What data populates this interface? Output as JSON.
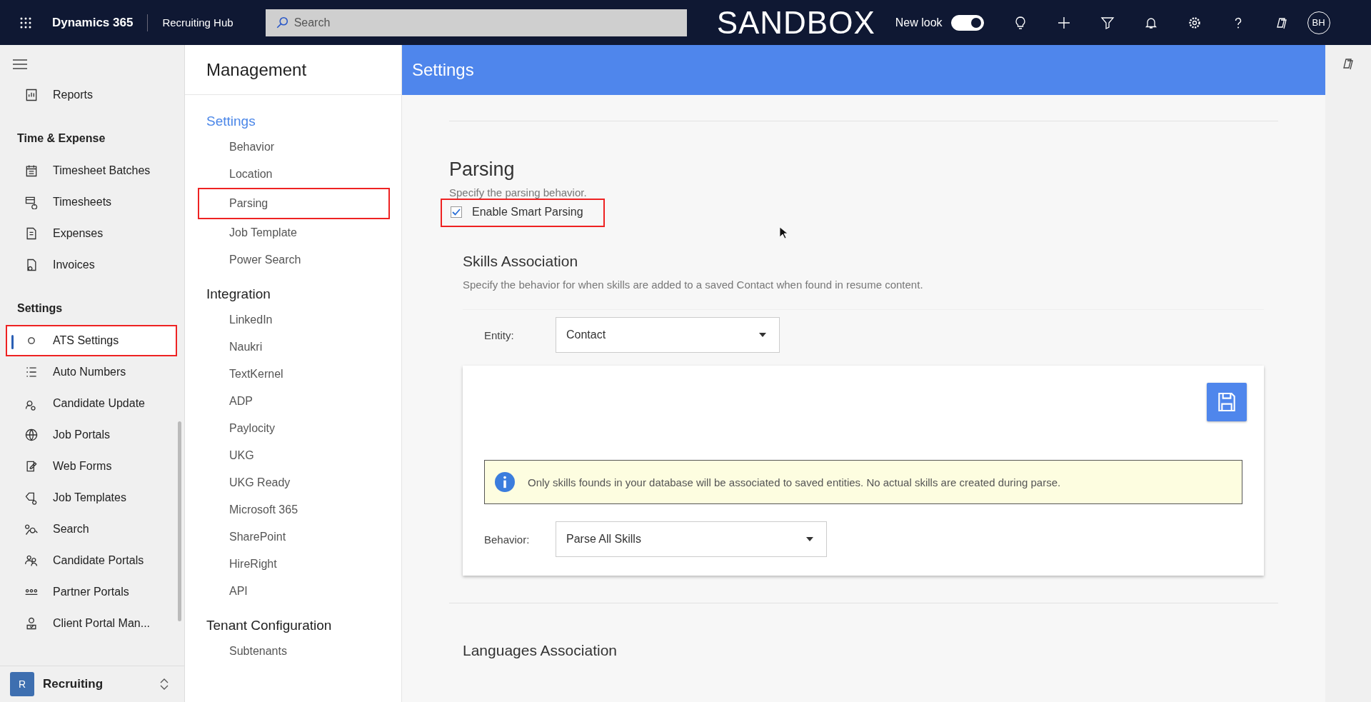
{
  "top_bar": {
    "app_name": "Dynamics 365",
    "area": "Recruiting Hub",
    "search": {
      "placeholder": "Search"
    },
    "environment": "SANDBOX",
    "new_look": {
      "label": "New look",
      "on": true
    },
    "avatar": "BH"
  },
  "nav": {
    "sections": [
      {
        "items": [
          {
            "label": "Reports",
            "selected": false,
            "highlighted": false
          }
        ]
      },
      {
        "title": "Time & Expense",
        "items": [
          {
            "label": "Timesheet Batches",
            "selected": false,
            "highlighted": false
          },
          {
            "label": "Timesheets",
            "selected": false,
            "highlighted": false
          },
          {
            "label": "Expenses",
            "selected": false,
            "highlighted": false
          },
          {
            "label": "Invoices",
            "selected": false,
            "highlighted": false
          }
        ]
      },
      {
        "title": "Settings",
        "items": [
          {
            "label": "ATS Settings",
            "selected": true,
            "highlighted": true
          },
          {
            "label": "Auto Numbers",
            "selected": false,
            "highlighted": false
          },
          {
            "label": "Candidate Update",
            "selected": false,
            "highlighted": false
          },
          {
            "label": "Job Portals",
            "selected": false,
            "highlighted": false
          },
          {
            "label": "Web Forms",
            "selected": false,
            "highlighted": false
          },
          {
            "label": "Job Templates",
            "selected": false,
            "highlighted": false
          },
          {
            "label": "Search",
            "selected": false,
            "highlighted": false
          },
          {
            "label": "Candidate Portals",
            "selected": false,
            "highlighted": false
          },
          {
            "label": "Partner Portals",
            "selected": false,
            "highlighted": false
          },
          {
            "label": "Client Portal Man...",
            "selected": false,
            "highlighted": false
          }
        ]
      }
    ],
    "area_switcher": {
      "badge": "R",
      "label": "Recruiting"
    }
  },
  "management": {
    "title": "Management",
    "groups": [
      {
        "title": "Settings",
        "selected": true,
        "items": [
          {
            "label": "Behavior",
            "highlighted": false
          },
          {
            "label": "Location",
            "highlighted": false
          },
          {
            "label": "Parsing",
            "highlighted": true
          },
          {
            "label": "Job Template",
            "highlighted": false
          },
          {
            "label": "Power Search",
            "highlighted": false
          }
        ]
      },
      {
        "title": "Integration",
        "selected": false,
        "items": [
          {
            "label": "LinkedIn",
            "highlighted": false
          },
          {
            "label": "Naukri",
            "highlighted": false
          },
          {
            "label": "TextKernel",
            "highlighted": false
          },
          {
            "label": "ADP",
            "highlighted": false
          },
          {
            "label": "Paylocity",
            "highlighted": false
          },
          {
            "label": "UKG",
            "highlighted": false
          },
          {
            "label": "UKG Ready",
            "highlighted": false
          },
          {
            "label": "Microsoft 365",
            "highlighted": false
          },
          {
            "label": "SharePoint",
            "highlighted": false
          },
          {
            "label": "HireRight",
            "highlighted": false
          },
          {
            "label": "API",
            "highlighted": false
          }
        ]
      },
      {
        "title": "Tenant Configuration",
        "selected": false,
        "items": [
          {
            "label": "Subtenants",
            "highlighted": false
          }
        ]
      }
    ]
  },
  "page": {
    "title": "Settings",
    "parsing": {
      "title": "Parsing",
      "description": "Specify the parsing behavior.",
      "checkbox": {
        "label": "Enable Smart Parsing",
        "checked": true,
        "highlighted": true
      }
    },
    "skills": {
      "title": "Skills Association",
      "description": "Specify the behavior for when skills are added to a saved Contact when found in resume content.",
      "entity": {
        "label": "Entity:",
        "value": "Contact"
      },
      "info": "Only skills founds in your database will be associated to saved entities. No actual skills are created during parse.",
      "behavior": {
        "label": "Behavior:",
        "value": "Parse All Skills"
      }
    },
    "next_section": "Languages Association"
  }
}
